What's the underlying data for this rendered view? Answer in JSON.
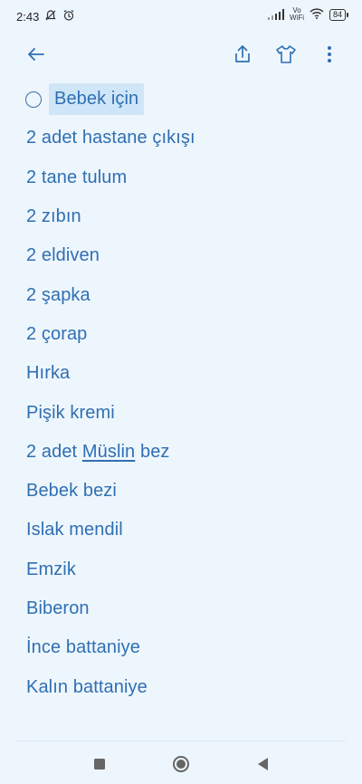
{
  "status": {
    "time": "2:43",
    "vo": "Vo",
    "wifi_label": "WiFi",
    "battery": "84"
  },
  "toolbar": {
    "back_icon": "arrow-left",
    "share_icon": "share",
    "shirt_icon": "tshirt",
    "more_icon": "more-vert"
  },
  "note": {
    "title": "Bebek için",
    "items": [
      "2 adet hastane çıkışı",
      "2 tane tulum",
      "2 zıbın",
      "2 eldiven",
      "2 şapka",
      "2 çorap",
      "Hırka",
      "Pişik kremi",
      "2 adet",
      "Müslin",
      "bez",
      "Bebek bezi",
      "Islak mendil",
      "Emzik",
      "Biberon",
      "İnce battaniye",
      "Kalın battaniye"
    ]
  },
  "colors": {
    "background": "#eef6fd",
    "text": "#2f6fb3",
    "highlight": "#cfe6f8"
  }
}
